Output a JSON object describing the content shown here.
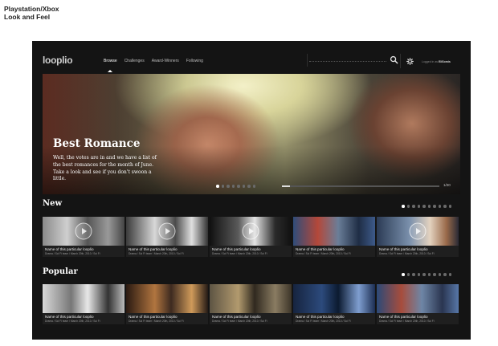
{
  "caption": {
    "line1": "Playstation/Xbox",
    "line2": "Look and Feel"
  },
  "header": {
    "logo": "looplio",
    "nav": [
      {
        "label": "Browse",
        "active": true
      },
      {
        "label": "Challenges",
        "active": false
      },
      {
        "label": "Award-Winners",
        "active": false
      },
      {
        "label": "Following",
        "active": false
      }
    ],
    "search": {
      "value": "",
      "placeholder": ""
    },
    "user": {
      "prefix": "Logged in as",
      "name": "EliSomis"
    }
  },
  "hero": {
    "title": "Best Romance",
    "description": "Well, the votes are in and we have a list of the best romances for the month of June. Take a look and see if you don't swoon a little.",
    "counter": "1/20",
    "progress": 0.05,
    "dot_count": 8,
    "active_dot": 0
  },
  "sections": [
    {
      "title": "New",
      "dot_count": 10,
      "active_dot": 0,
      "cards": [
        {
          "title": "Name of this particular looplio",
          "meta": "Drama / Sci Fi team / March 20th, 2010 / Sci Fi",
          "thumb": "t1",
          "play": true
        },
        {
          "title": "Name of this particular looplio",
          "meta": "Drama / Sci Fi team / March 20th, 2010 / Sci Fi",
          "thumb": "t2",
          "play": true
        },
        {
          "title": "Name of this particular looplio",
          "meta": "Drama / Sci Fi team / March 20th, 2010 / Sci Fi",
          "thumb": "t3",
          "play": true
        },
        {
          "title": "Name of this particular looplio",
          "meta": "Drama / Sci Fi team / March 20th, 2010 / Sci Fi",
          "thumb": "t4",
          "play": false
        },
        {
          "title": "Name of this particular looplio",
          "meta": "Drama / Sci Fi team / March 20th, 2010 / Sci Fi",
          "thumb": "t5",
          "play": true
        }
      ]
    },
    {
      "title": "Popular",
      "dot_count": 10,
      "active_dot": 0,
      "cards": [
        {
          "title": "Name of this particular looplio",
          "meta": "Drama / Sci Fi team / March 20th, 2010 / Sci Fi",
          "thumb": "p1",
          "play": false
        },
        {
          "title": "Name of this particular looplio",
          "meta": "Drama / Sci Fi team / March 20th, 2010 / Sci Fi",
          "thumb": "p2",
          "play": false
        },
        {
          "title": "Name of this particular looplio",
          "meta": "Drama / Sci Fi team / March 20th, 2010 / Sci Fi",
          "thumb": "p3",
          "play": false
        },
        {
          "title": "Name of this particular looplio",
          "meta": "Drama / Sci Fi team / March 20th, 2010 / Sci Fi",
          "thumb": "p4",
          "play": false
        },
        {
          "title": "Name of this particular looplio",
          "meta": "Drama / Sci Fi team / March 20th, 2010 / Sci Fi",
          "thumb": "p5",
          "play": false
        }
      ]
    }
  ],
  "icons": {
    "search": "search-icon",
    "settings": "gear-icon",
    "play": "play-icon"
  },
  "colors": {
    "background": "#141414",
    "text": "#ffffff",
    "card_info": "#1f1f1f",
    "inactive_dot": "#6a6a6a"
  }
}
